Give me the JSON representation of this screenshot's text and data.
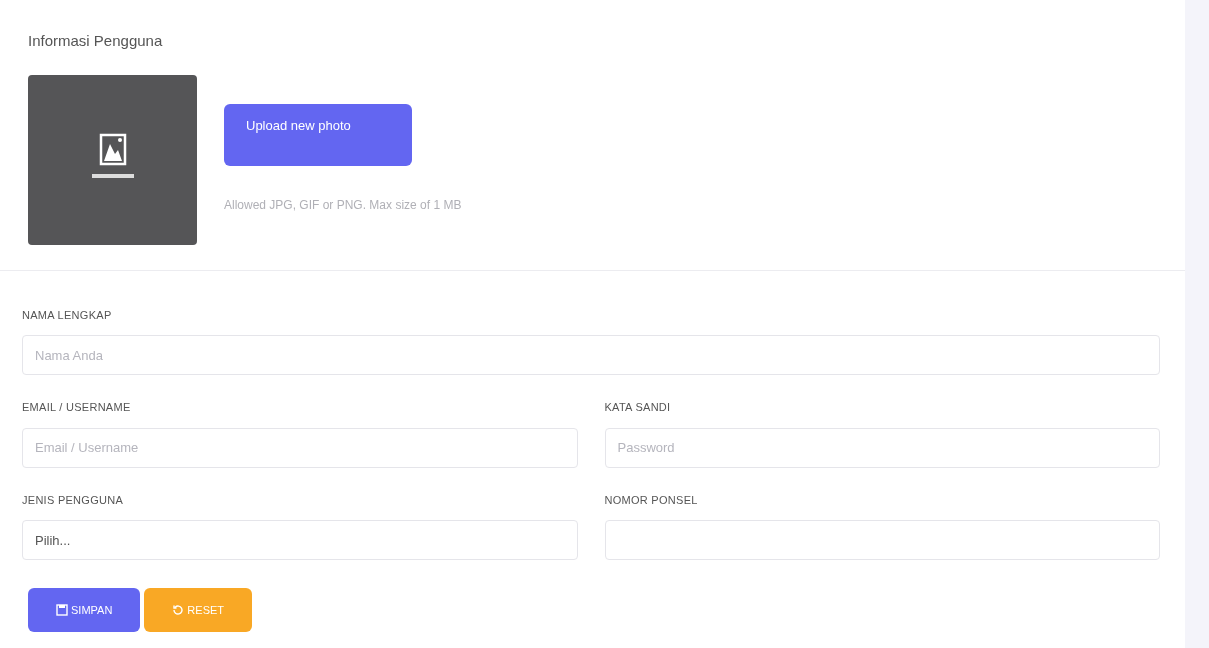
{
  "title": "Informasi Pengguna",
  "upload_button": "Upload new photo",
  "upload_hint": "Allowed JPG, GIF or PNG. Max size of 1 MB",
  "field_rows": [
    [
      {
        "label": "NAMA LENGKAP",
        "placeholder": "Nama Anda"
      }
    ],
    [
      {
        "label": "EMAIL / USERNAME",
        "placeholder": "Email / Username"
      },
      {
        "label": "KATA SANDI",
        "placeholder": "Password"
      }
    ],
    [
      {
        "label": "JENIS PENGGUNA",
        "value": "Pilih..."
      },
      {
        "label": "NOMOR PONSEL"
      }
    ]
  ],
  "buttons": [
    {
      "label": "SIMPAN",
      "kind": "save"
    },
    {
      "label": "RESET",
      "kind": "reset"
    }
  ]
}
